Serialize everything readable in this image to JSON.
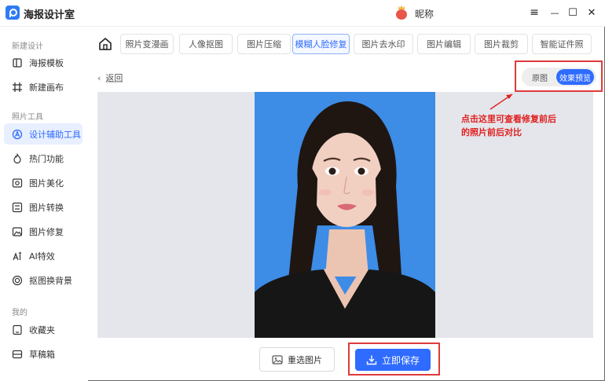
{
  "app": {
    "title": "海报设计室",
    "username": "昵称"
  },
  "window_controls": {
    "menu": "≡",
    "minimize": "—",
    "maximize": "☐",
    "close": "✕"
  },
  "sidebar": {
    "groups": [
      {
        "label": "新建设计",
        "items": [
          {
            "label": "海报模板"
          },
          {
            "label": "新建画布"
          }
        ]
      },
      {
        "label": "照片工具",
        "items": [
          {
            "label": "设计辅助工具",
            "active": true
          },
          {
            "label": "热门功能"
          },
          {
            "label": "图片美化"
          },
          {
            "label": "图片转换"
          },
          {
            "label": "图片修复"
          },
          {
            "label": "AI特效"
          },
          {
            "label": "抠图换背景"
          }
        ]
      },
      {
        "label": "我的",
        "items": [
          {
            "label": "收藏夹"
          },
          {
            "label": "草稿箱"
          }
        ]
      }
    ]
  },
  "tabs": [
    {
      "label": "照片变漫画"
    },
    {
      "label": "人像抠图"
    },
    {
      "label": "图片压缩"
    },
    {
      "label": "模糊人脸修复",
      "active": true
    },
    {
      "label": "图片去水印"
    },
    {
      "label": "图片编辑"
    },
    {
      "label": "图片裁剪"
    },
    {
      "label": "智能证件照"
    }
  ],
  "back_label": "返回",
  "compare": {
    "original": "原图",
    "preview": "效果预览",
    "selected": "效果预览"
  },
  "annotation": {
    "line1": "点击这里可查看修复前后",
    "line2": "的照片前后对比"
  },
  "actions": {
    "reselect": "重选图片",
    "save": "立即保存"
  },
  "colors": {
    "accent": "#2f6bff",
    "annotation": "#e03a3a",
    "photo_background": "#3d8ce6"
  }
}
